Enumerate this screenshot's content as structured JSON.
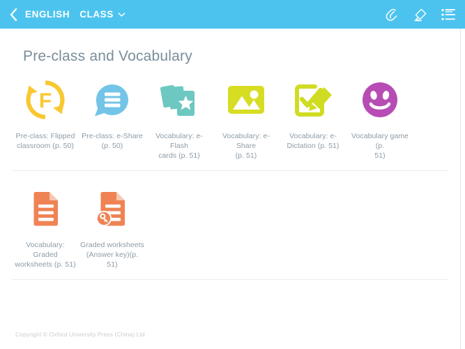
{
  "header": {
    "back_icon": "chevron-left-icon",
    "breadcrumb_primary": "ENGLISH",
    "breadcrumb_secondary": "CLASS",
    "dropdown_icon": "chevron-down-icon",
    "actions": [
      {
        "name": "attachment-icon",
        "label": "Attachment"
      },
      {
        "name": "highlighter-pen-icon",
        "label": "Annotate"
      },
      {
        "name": "list-menu-icon",
        "label": "Contents list"
      }
    ],
    "background_color": "#4cc3ee"
  },
  "main": {
    "title": "Pre-class and Vocabulary",
    "rows": [
      {
        "tiles": [
          {
            "icon": "refresh-flipped-classroom-icon",
            "color": "#f9c831",
            "label_line1": "Pre-class: Flipped",
            "label_line2": "classroom (p. 50)"
          },
          {
            "icon": "speech-bubble-lines-icon",
            "color": "#73c4e8",
            "label_line1": "Pre-class: e-Share",
            "label_line2": "(p. 50)"
          },
          {
            "icon": "flash-cards-star-icon",
            "color": "#6cc8c0",
            "label_line1": "Vocabulary: e-Flash",
            "label_line2": "cards (p. 51)"
          },
          {
            "icon": "picture-image-icon",
            "color": "#d7dd22",
            "label_line1": "Vocabulary: e-Share",
            "label_line2": "(p. 51)"
          },
          {
            "icon": "checkbox-pencil-icon",
            "color": "#d0dc22",
            "label_line1": "Vocabulary: e-",
            "label_line2": "Dictation (p. 51)"
          },
          {
            "icon": "smiley-face-icon",
            "color": "#b74cb4",
            "label_line1": "Vocabulary game (p.",
            "label_line2": "51)"
          }
        ]
      },
      {
        "tiles": [
          {
            "icon": "document-lines-icon",
            "color": "#ef8354",
            "label_line1": "Vocabulary: Graded",
            "label_line2": "worksheets (p. 51)"
          },
          {
            "icon": "document-key-icon",
            "color": "#ef8354",
            "label_line1": "Graded worksheets",
            "label_line2": "(Answer key)(p. 51)"
          }
        ]
      }
    ]
  },
  "footer": {
    "copyright": "Copyright © Oxford University Press (China) Ltd"
  }
}
